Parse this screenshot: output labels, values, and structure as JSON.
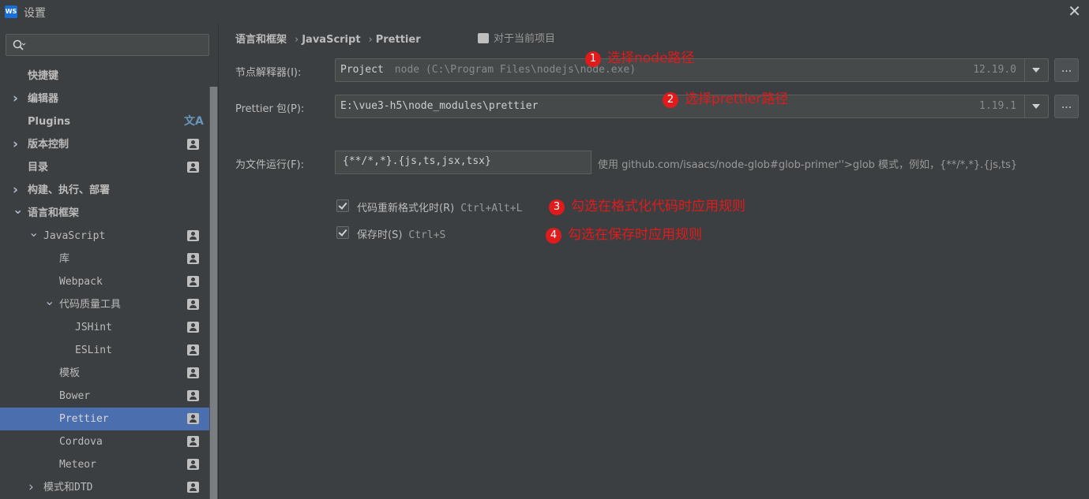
{
  "window": {
    "title": "设置",
    "app_icon": "WS"
  },
  "search": {
    "placeholder": "",
    "value": ""
  },
  "sidebar": {
    "items": [
      {
        "label": "快捷键",
        "indent": 0,
        "arrow": "",
        "bold": true,
        "icon": ""
      },
      {
        "label": "编辑器",
        "indent": 0,
        "arrow": "collapsed",
        "bold": true,
        "icon": ""
      },
      {
        "label": "Plugins",
        "indent": 0,
        "arrow": "",
        "bold": true,
        "icon": "translate-icon"
      },
      {
        "label": "版本控制",
        "indent": 0,
        "arrow": "collapsed",
        "bold": true,
        "icon": "person-icon"
      },
      {
        "label": "目录",
        "indent": 0,
        "arrow": "",
        "bold": true,
        "icon": "person-icon"
      },
      {
        "label": "构建、执行、部署",
        "indent": 0,
        "arrow": "collapsed",
        "bold": true,
        "icon": ""
      },
      {
        "label": "语言和框架",
        "indent": 0,
        "arrow": "expanded",
        "bold": true,
        "icon": ""
      },
      {
        "label": "JavaScript",
        "indent": 1,
        "arrow": "expanded",
        "bold": false,
        "icon": "person-icon"
      },
      {
        "label": "库",
        "indent": 2,
        "arrow": "",
        "bold": false,
        "icon": "person-icon"
      },
      {
        "label": "Webpack",
        "indent": 2,
        "arrow": "",
        "bold": false,
        "icon": "person-icon"
      },
      {
        "label": "代码质量工具",
        "indent": 2,
        "arrow": "expanded",
        "bold": false,
        "icon": "person-icon"
      },
      {
        "label": "JSHint",
        "indent": 3,
        "arrow": "",
        "bold": false,
        "icon": "person-icon"
      },
      {
        "label": "ESLint",
        "indent": 3,
        "arrow": "",
        "bold": false,
        "icon": "person-icon"
      },
      {
        "label": "模板",
        "indent": 2,
        "arrow": "",
        "bold": false,
        "icon": "person-icon"
      },
      {
        "label": "Bower",
        "indent": 2,
        "arrow": "",
        "bold": false,
        "icon": "person-icon"
      },
      {
        "label": "Prettier",
        "indent": 2,
        "arrow": "",
        "bold": false,
        "icon": "person-icon",
        "selected": true
      },
      {
        "label": "Cordova",
        "indent": 2,
        "arrow": "",
        "bold": false,
        "icon": "person-icon"
      },
      {
        "label": "Meteor",
        "indent": 2,
        "arrow": "",
        "bold": false,
        "icon": "person-icon"
      },
      {
        "label": "模式和DTD",
        "indent": 1,
        "arrow": "collapsed",
        "bold": false,
        "icon": "person-icon"
      }
    ]
  },
  "breadcrumb": {
    "parts": [
      "语言和框架",
      "JavaScript",
      "Prettier"
    ],
    "sep": "›"
  },
  "project_note": "对于当前项目",
  "node_interpreter": {
    "label": "节点解释器(I):",
    "value": "Project",
    "path": "node (C:\\Program Files\\nodejs\\node.exe)",
    "version": "12.19.0",
    "more": "..."
  },
  "prettier_package": {
    "label": "Prettier 包(P):",
    "value": "E:\\vue3-h5\\node_modules\\prettier",
    "version": "1.19.1",
    "more": "..."
  },
  "run_for_files": {
    "label": "为文件运行(F):",
    "value": "{**/*,*}.{js,ts,jsx,tsx}",
    "hint": "使用 github.com/isaacs/node-glob#glob-primer''>glob 模式，例如，{**/*,*}.{js,ts}"
  },
  "checkboxes": [
    {
      "label": "代码重新格式化时(R)",
      "shortcut": "Ctrl+Alt+L",
      "checked": true
    },
    {
      "label": "保存时(S)",
      "shortcut": "Ctrl+S",
      "checked": true
    }
  ],
  "annotations": [
    {
      "num": "1",
      "text": "选择node路径"
    },
    {
      "num": "2",
      "text": "选择prettier路径"
    },
    {
      "num": "3",
      "text": "勾选在格式化代码时应用规则"
    },
    {
      "num": "4",
      "text": "勾选在保存时应用规则"
    }
  ],
  "colors": {
    "background": "#3c3f41",
    "selected": "#4b6eaf",
    "annotation": "#e01b1b"
  }
}
